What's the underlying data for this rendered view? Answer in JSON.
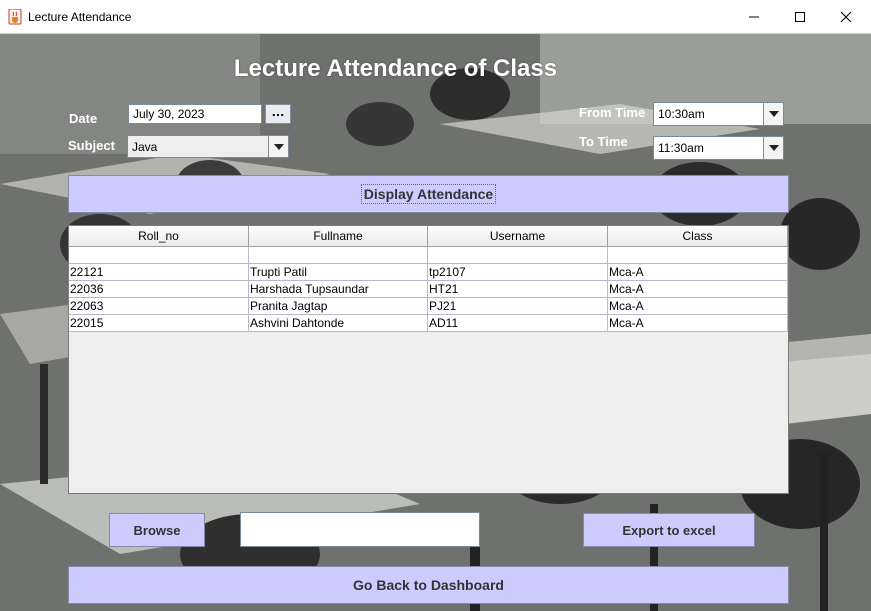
{
  "window": {
    "title": "Lecture Attendance",
    "icon": "java-cup-icon"
  },
  "header": {
    "title": "Lecture Attendance of Class"
  },
  "form": {
    "date_label": "Date",
    "date_value": "July 30, 2023",
    "date_picker_label": "...",
    "subject_label": "Subject",
    "subject_value": "Java",
    "from_time_label": "From Time",
    "from_time_value": "10:30am",
    "to_time_label": "To Time",
    "to_time_value": "11:30am"
  },
  "display_button": "Display Attendance",
  "table": {
    "columns": [
      "Roll_no",
      "Fullname",
      "Username",
      "Class"
    ],
    "rows": [
      [
        "",
        "",
        "",
        ""
      ],
      [
        "22121",
        "Trupti Patil",
        "tp2107",
        "Mca-A"
      ],
      [
        "22036",
        "Harshada Tupsaundar",
        "HT21",
        "Mca-A"
      ],
      [
        "22063",
        "Pranita Jagtap",
        "PJ21",
        "Mca-A"
      ],
      [
        "22015",
        "Ashvini Dahtonde",
        "AD11",
        "Mca-A"
      ]
    ]
  },
  "bottom": {
    "browse_label": "Browse",
    "path_value": "",
    "export_label": "Export to excel",
    "back_label": "Go Back to Dashboard"
  },
  "colors": {
    "button_bg": "#ccccff",
    "title_text": "#ffffff"
  }
}
